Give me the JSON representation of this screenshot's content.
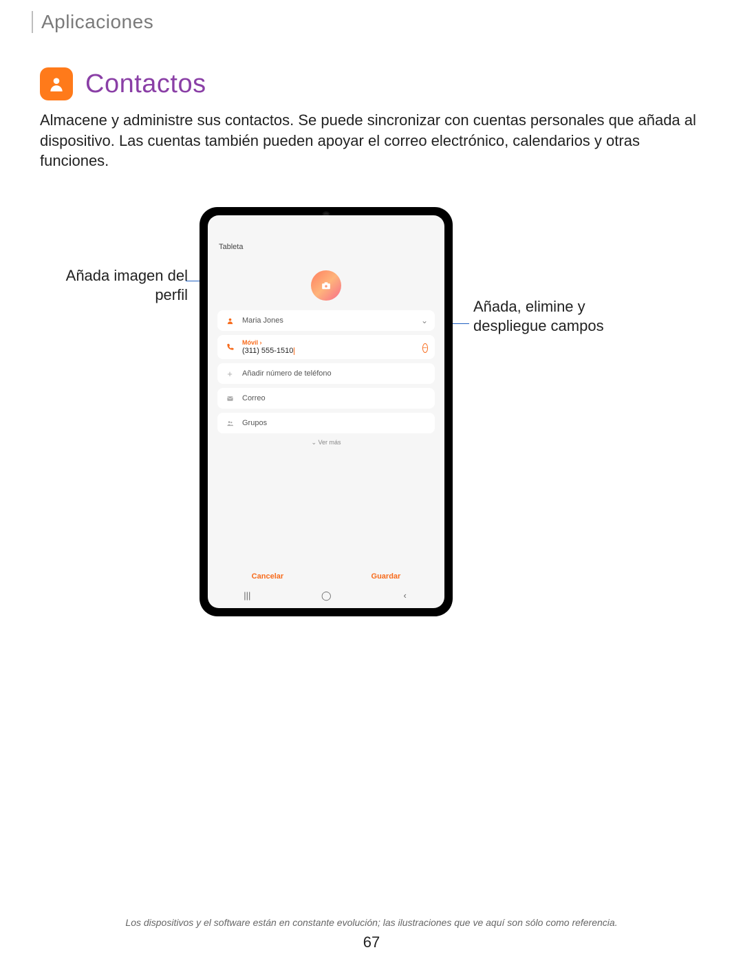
{
  "header": {
    "section": "Aplicaciones"
  },
  "title": "Contactos",
  "description": "Almacene y administre sus contactos. Se puede sincronizar con cuentas personales que añada al dispositivo. Las cuentas también pueden apoyar el correo electrónico, calendarios y otras funciones.",
  "annotations": {
    "profile_image": "Añada imagen del perfil",
    "fields": "Añada, elimine y despliegue campos"
  },
  "tablet": {
    "screen_label": "Tableta",
    "name_field": "Maria Jones",
    "phone": {
      "label": "Móvil",
      "value": "(311) 555-1510"
    },
    "add_phone": "Añadir número de teléfono",
    "email": "Correo",
    "groups": "Grupos",
    "see_more": "Ver más",
    "cancel": "Cancelar",
    "save": "Guardar"
  },
  "footer": {
    "disclaimer": "Los dispositivos y el software están en constante evolución; las ilustraciones que ve aquí son sólo como referencia.",
    "page": "67"
  }
}
